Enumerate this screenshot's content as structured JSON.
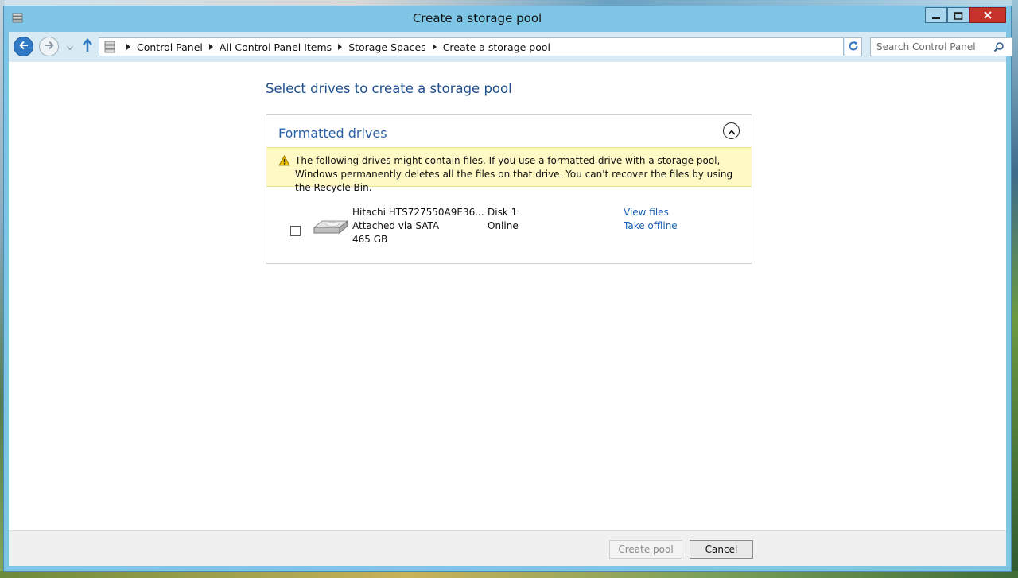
{
  "window": {
    "title": "Create a storage pool",
    "icon": "control-panel-icon",
    "controls": [
      "minimize-icon",
      "maximize-icon",
      "close-icon"
    ]
  },
  "navigation": {
    "back_icon": "back-arrow-icon",
    "forward_icon": "forward-arrow-icon",
    "recent_icon": "chevron-down-icon",
    "up_icon": "up-arrow-icon",
    "breadcrumbs": [
      "Control Panel",
      "All Control Panel Items",
      "Storage Spaces",
      "Create a storage pool"
    ],
    "refresh_icon": "refresh-icon",
    "search": {
      "placeholder": "Search Control Panel",
      "value": "",
      "icon": "search-icon"
    }
  },
  "main": {
    "heading": "Select drives to create a storage pool",
    "group": {
      "title": "Formatted drives",
      "collapse_icon": "chevron-up-circle-icon",
      "warning": {
        "icon": "warning-icon",
        "text": "The following drives might contain files. If you use a formatted drive with a storage pool, Windows permanently deletes all the files on that drive. You can't recover the files by using the Recycle Bin."
      },
      "drives": [
        {
          "checked": false,
          "icon": "hard-drive-icon",
          "name": "Hitachi HTS727550A9E36...",
          "connection": "Attached via SATA",
          "size": "465 GB",
          "disk": "Disk 1",
          "status": "Online",
          "actions": [
            "View files",
            "Take offline"
          ]
        }
      ]
    }
  },
  "footer": {
    "create_label": "Create pool",
    "cancel_label": "Cancel"
  },
  "colors": {
    "title_bar": "#7fc6e6",
    "heading": "#1e4e8c",
    "link": "#1a5fb4",
    "warning_bg": "#fff9c5",
    "close_button": "#c7312b"
  }
}
